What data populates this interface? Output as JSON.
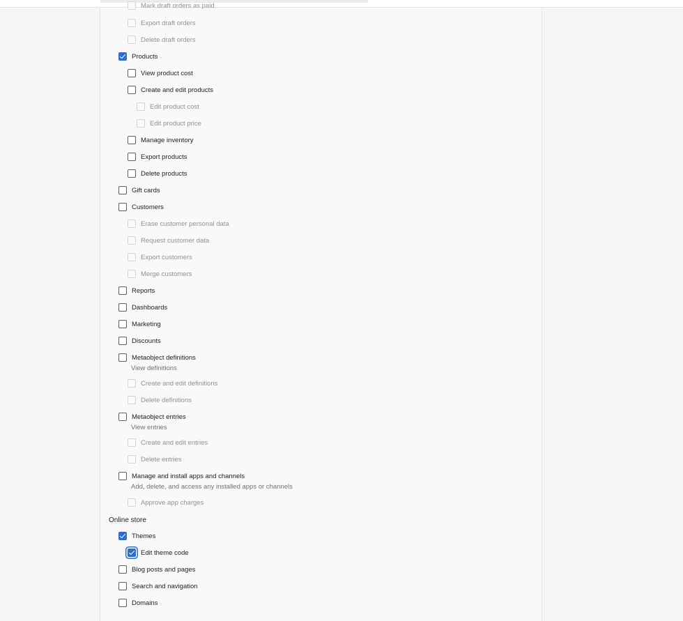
{
  "items": [
    {
      "label": "Mark draft orders as paid",
      "checked": false,
      "disabled": true
    },
    {
      "label": "Export draft orders",
      "checked": false,
      "disabled": true
    },
    {
      "label": "Delete draft orders",
      "checked": false,
      "disabled": true
    },
    {
      "label": "Products",
      "checked": true,
      "disabled": false
    },
    {
      "label": "View product cost",
      "checked": false,
      "disabled": false
    },
    {
      "label": "Create and edit products",
      "checked": false,
      "disabled": false
    },
    {
      "label": "Edit product cost",
      "checked": false,
      "disabled": true
    },
    {
      "label": "Edit product price",
      "checked": false,
      "disabled": true
    },
    {
      "label": "Manage inventory",
      "checked": false,
      "disabled": false
    },
    {
      "label": "Export products",
      "checked": false,
      "disabled": false
    },
    {
      "label": "Delete products",
      "checked": false,
      "disabled": false
    },
    {
      "label": "Gift cards",
      "checked": false,
      "disabled": false
    },
    {
      "label": "Customers",
      "checked": false,
      "disabled": false
    },
    {
      "label": "Erase customer personal data",
      "checked": false,
      "disabled": true
    },
    {
      "label": "Request customer data",
      "checked": false,
      "disabled": true
    },
    {
      "label": "Export customers",
      "checked": false,
      "disabled": true
    },
    {
      "label": "Merge customers",
      "checked": false,
      "disabled": true
    },
    {
      "label": "Reports",
      "checked": false,
      "disabled": false
    },
    {
      "label": "Dashboards",
      "checked": false,
      "disabled": false
    },
    {
      "label": "Marketing",
      "checked": false,
      "disabled": false
    },
    {
      "label": "Discounts",
      "checked": false,
      "disabled": false
    },
    {
      "label": "Metaobject definitions",
      "checked": false,
      "disabled": false,
      "help": "View definitions"
    },
    {
      "label": "Create and edit definitions",
      "checked": false,
      "disabled": true
    },
    {
      "label": "Delete definitions",
      "checked": false,
      "disabled": true
    },
    {
      "label": "Metaobject entries",
      "checked": false,
      "disabled": false,
      "help": "View entries"
    },
    {
      "label": "Create and edit entries",
      "checked": false,
      "disabled": true
    },
    {
      "label": "Delete entries",
      "checked": false,
      "disabled": true
    },
    {
      "label": "Manage and install apps and channels",
      "checked": false,
      "disabled": false,
      "help": "Add, delete, and access any installed apps or channels"
    },
    {
      "label": "Approve app charges",
      "checked": false,
      "disabled": true
    },
    {
      "label": "Themes",
      "checked": true,
      "disabled": false
    },
    {
      "label": "Edit theme code",
      "checked": true,
      "disabled": false
    },
    {
      "label": "Blog posts and pages",
      "checked": false,
      "disabled": false
    },
    {
      "label": "Search and navigation",
      "checked": false,
      "disabled": false
    },
    {
      "label": "Domains",
      "checked": false,
      "disabled": false
    }
  ],
  "sections": {
    "online_store": "Online store"
  },
  "colors": {
    "accent": "#2c6ecb",
    "background": "#f6f6f7",
    "panel": "#f9f9fa"
  }
}
